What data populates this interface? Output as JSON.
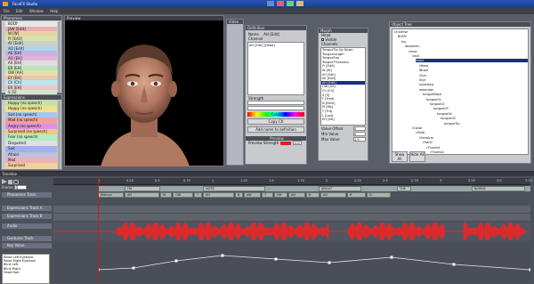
{
  "window": {
    "title": "FaceFX Studio"
  },
  "menu": [
    "File",
    "Edit",
    "Window",
    "Help"
  ],
  "phonemes_panel": {
    "title": "Phonemes",
    "items": [
      {
        "label": "BODY",
        "color": "#e7e7e7"
      },
      {
        "label": "JAW [Edit]",
        "color": "#e8b0b0"
      },
      {
        "label": "W [W]",
        "color": "#e7d3a6"
      },
      {
        "label": "IY [Edit]",
        "color": "#d5e5a8"
      },
      {
        "label": "AY [Edit]",
        "color": "#cfcfcf"
      },
      {
        "label": "AO [Edit]",
        "color": "#a8d8e6"
      },
      {
        "label": "AE [EH]",
        "color": "#c6b2e6"
      },
      {
        "label": "AO [EH]",
        "color": "#e6b2d8"
      },
      {
        "label": "AX [EH]",
        "color": "#ddd"
      },
      {
        "label": "ER [EH]",
        "color": "#b8e6b8"
      },
      {
        "label": "OW [AA]",
        "color": "#e6e0a8"
      },
      {
        "label": "EY [EH]",
        "color": "#e6c8b2"
      },
      {
        "label": "Ch [Ch]",
        "color": "#bde4f0"
      },
      {
        "label": "ER [EH]",
        "color": "#f0c4c4"
      },
      {
        "label": "S [S]",
        "color": "#cfe9cf"
      }
    ]
  },
  "expressions_panel": {
    "title": "Expressions",
    "items": [
      {
        "label": "Happy (no speech)",
        "color": "#c8e0a0"
      },
      {
        "label": "Happy (no speech)",
        "color": "#f0e090"
      },
      {
        "label": "Sad (no speech)",
        "color": "#a0c8f0"
      },
      {
        "label": "Mad (no speech)",
        "color": "#f0a0a0"
      },
      {
        "label": "Angry (no speech)",
        "color": "#e090e0"
      },
      {
        "label": "Surprised (no speech)",
        "color": "#f0c890"
      },
      {
        "label": "Fear (no speech)",
        "color": "#b0f0c0"
      },
      {
        "label": "Disgusted",
        "color": "#e0e0e0"
      },
      {
        "label": "Sad",
        "color": "#a0b0f0"
      },
      {
        "label": "Afraid",
        "color": "#c0c0e0"
      },
      {
        "label": "Mad",
        "color": "#f0b0b0"
      },
      {
        "label": "Surprised",
        "color": "#f0d0a0"
      }
    ]
  },
  "viewport": {
    "title": "Preview"
  },
  "video_panel": {
    "title": "Video"
  },
  "definition_panel": {
    "title": "Definition",
    "name_label": "Name",
    "name_value": "AH [Edit]",
    "channel_label": "Channel",
    "list": [
      "AH [Edit] [Head]"
    ],
    "strength_label": "Strength",
    "color_label": "Color",
    "copy_label": "Copy Ctl",
    "add_btn": "Add name to definition",
    "preview_label": "Preview",
    "preview_strength_label": "Preview Strength",
    "preview_strength_value": "100"
  },
  "morph_panel": {
    "title": "Morph",
    "label": "Head",
    "checkbox_label": "Visible",
    "channels_label": "Channels",
    "items": [
      "TongueTip Up Down",
      "TongueLength",
      "TongueFlat",
      "TongueThickness",
      "IY [Edit]",
      "W [W]",
      "AY [Edit]",
      "AE [Edit]",
      "AH [Edit]",
      "OW [AA]",
      "Ch [Ch]",
      "S [S]",
      "F [Fred]",
      "N [Ninh]",
      "M [Mb]",
      "T [Trd]",
      "L [Lod]",
      "EH [AA]"
    ],
    "selected_index": 8,
    "value_offset_label": "Value Offset",
    "value_offset": "0",
    "min_label": "Min Value",
    "min": "0",
    "max_label": "Max Value",
    "max": "1.5"
  },
  "tree_panel": {
    "title": "Object Tree",
    "nodes": [
      {
        "label": "Universe",
        "depth": 0
      },
      {
        "label": "BODY",
        "depth": 1
      },
      {
        "label": "hip",
        "depth": 2
      },
      {
        "label": "abdomen",
        "depth": 3
      },
      {
        "label": "chest",
        "depth": 4
      },
      {
        "label": "neck",
        "depth": 5
      },
      {
        "label": "head",
        "depth": 6,
        "selected": true
      },
      {
        "label": "rBrow",
        "depth": 7
      },
      {
        "label": "lBrow",
        "depth": 7
      },
      {
        "label": "rEye",
        "depth": 7
      },
      {
        "label": "lEye",
        "depth": 7
      },
      {
        "label": "upperJaw",
        "depth": 7
      },
      {
        "label": "lowerJaw",
        "depth": 7
      },
      {
        "label": "tongueBase",
        "depth": 8
      },
      {
        "label": "tongue01",
        "depth": 9
      },
      {
        "label": "tongue02",
        "depth": 10
      },
      {
        "label": "tongue03",
        "depth": 11
      },
      {
        "label": "tongue04",
        "depth": 12
      },
      {
        "label": "tongue05",
        "depth": 13
      },
      {
        "label": "tongueTip",
        "depth": 14
      },
      {
        "label": "rCollar",
        "depth": 5
      },
      {
        "label": "rShldr",
        "depth": 6
      },
      {
        "label": "rForeArm",
        "depth": 7
      },
      {
        "label": "rHand",
        "depth": 8
      },
      {
        "label": "rThumb1",
        "depth": 9
      },
      {
        "label": "rThumb2",
        "depth": 10
      }
    ],
    "bottom_a": "Show All",
    "bottom_b": "Hide All"
  },
  "timeline": {
    "title": "Timeline",
    "frame_label": "Frame",
    "frame_value": "0",
    "ruler_ticks": [
      "0",
      "0.25",
      "0.5",
      "0.75",
      "1",
      "1.25",
      "1.5",
      "1.75",
      "2",
      "2.25",
      "2.5",
      "2.75",
      "3",
      "3.25",
      "3.5",
      "3.75"
    ],
    "words": [
      "I'M",
      "NOTE",
      "ABOUT",
      "THE",
      "BORED"
    ],
    "tracks": [
      {
        "name": "Phonemes Track"
      },
      {
        "name": "Expressions Track A"
      },
      {
        "name": "Expressions Track B"
      },
      {
        "name": "Audio"
      },
      {
        "name": "Gestures Track"
      },
      {
        "name": "Key Value"
      }
    ],
    "phoneme_segments": [
      "Silence",
      "AH",
      "M",
      "OW",
      "T",
      "AH",
      "B",
      "AW",
      "T",
      "DH",
      "AH",
      "B",
      "AO",
      "R",
      "D"
    ],
    "curve_list": [
      "Raise Left Eyebrow",
      "Raise Right Eyebrow",
      "Blink Left",
      "Blink Right",
      "Head Nod"
    ]
  },
  "colors": {
    "accent": "#1a2f80",
    "waveform": "#ff2020",
    "playhead": "#c02020"
  }
}
